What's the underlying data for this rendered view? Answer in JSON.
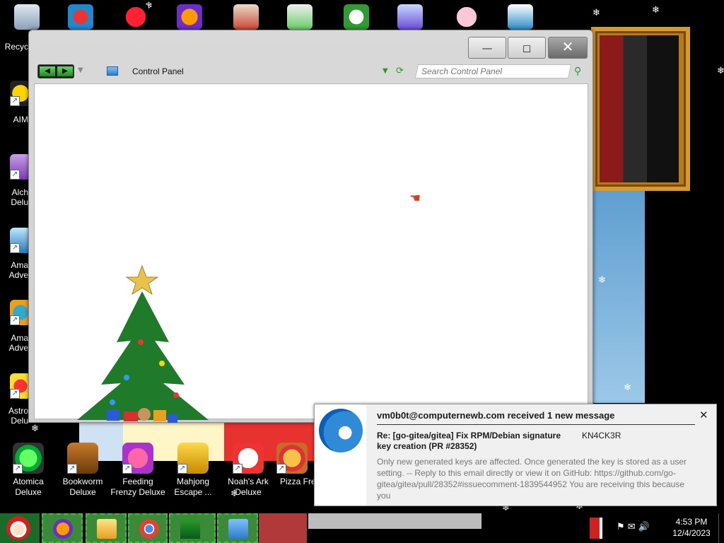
{
  "desktop": {
    "left_icons": [
      {
        "label": "Recyc",
        "name": "recycle-bin"
      },
      {
        "label": "AIM",
        "name": "aim"
      },
      {
        "label": "Alch",
        "label2": "Delu",
        "name": "alchemy"
      },
      {
        "label": "Ama",
        "label2": "Adve",
        "name": "amazing-adventures-1"
      },
      {
        "label": "Ama",
        "label2": "Adve",
        "name": "amazing-adventures-2"
      },
      {
        "label": "Astro",
        "label2": "Delu",
        "name": "astro"
      }
    ],
    "bottom_icons": [
      {
        "label": "Atomica",
        "label2": "Deluxe"
      },
      {
        "label": "Bookworm",
        "label2": "Deluxe"
      },
      {
        "label": "Feeding",
        "label2": "Frenzy Deluxe"
      },
      {
        "label": "Mahjong",
        "label2": "Escape ..."
      },
      {
        "label": "Noah's Ark",
        "label2": "Deluxe"
      },
      {
        "label": "Pizza Fren",
        "label2": ""
      }
    ]
  },
  "window": {
    "address": "Control Panel",
    "search_placeholder": "Search Control Panel",
    "minimize_glyph": "—",
    "maximize_glyph": "◻",
    "close_glyph": "✕"
  },
  "notification": {
    "title": "vm0b0t@computernewb.com received 1 new message",
    "subject": "Re: [go-gitea/gitea] Fix RPM/Debian signature key creation (PR #28352)",
    "from": "KN4CK3R",
    "body": "Only new generated keys are affected. Once generated the key is stored as a user setting. -- Reply to this email directly or view it on GitHub: https://github.com/go-gitea/gitea/pull/28352#issuecomment-1839544952 You are receiving this because you",
    "close_glyph": "✕"
  },
  "taskbar": {
    "clock_time": "4:53 PM",
    "clock_date": "12/4/2023"
  },
  "colors": {
    "taskbar_green": "#3fbf3f",
    "window_chrome": "#d9d9d9",
    "accent_blue": "#2f8bd8"
  }
}
